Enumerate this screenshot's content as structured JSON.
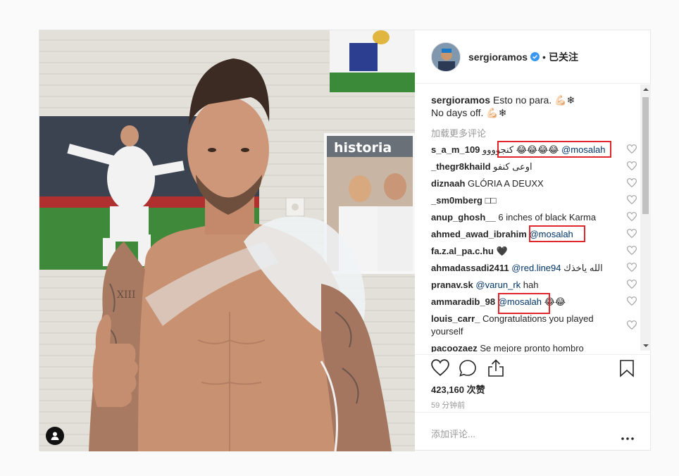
{
  "post": {
    "username": "sergioramos",
    "verified": true,
    "follow_status": "已关注",
    "caption_user": "sergioramos",
    "caption_text": "Esto no para. 💪🏻❄",
    "caption_text2": "No days off. 💪🏻❄",
    "load_more": "加载更多评论",
    "likes": "423,160 次赞",
    "time_ago": "59 分钟前",
    "add_comment_placeholder": "添加评论...",
    "photo_poster_text": "historia"
  },
  "comments": [
    {
      "user": "s_a_m_109",
      "text": "كنجوووو 😂😂😂😂",
      "mention": "@mosalah",
      "highlighted": true
    },
    {
      "user": "_thegr8khaild",
      "text": "اوعى كنفو",
      "mention": "",
      "highlighted": false
    },
    {
      "user": "diznaah",
      "text": "GLÓRIA A DEUXX",
      "mention": "",
      "highlighted": false
    },
    {
      "user": "_sm0mberg",
      "text": "□□",
      "mention": "",
      "highlighted": false
    },
    {
      "user": "anup_ghosh__",
      "text": "6 inches of black Karma",
      "mention": "",
      "highlighted": false
    },
    {
      "user": "ahmed_awad_ibrahim",
      "text": "",
      "mention": "@mosalah",
      "highlighted": true
    },
    {
      "user": "fa.z.al_pa.c.hu",
      "text": "🖤",
      "mention": "",
      "highlighted": false
    },
    {
      "user": "ahmadassadi2411",
      "text": "الله ياخذك",
      "mention": "@red.line94",
      "highlighted": false
    },
    {
      "user": "pranav.sk",
      "text": "hah",
      "mention": "@varun_rk",
      "highlighted": false
    },
    {
      "user": "ammaradib_98",
      "text": "😂😂",
      "mention": "@mosalah",
      "highlighted": true
    },
    {
      "user": "louis_carr_",
      "text": "Congratulations you played yourself",
      "mention": "",
      "highlighted": false
    },
    {
      "user": "pacoozaez",
      "text": "Se mejore pronto hombro",
      "mention": "",
      "highlighted": false
    }
  ],
  "icons": {
    "like": "heart-outline-icon",
    "comment": "speech-bubble-icon",
    "share": "share-icon",
    "save": "bookmark-icon",
    "more": "ellipsis-icon",
    "tag": "user-tag-icon",
    "verified": "verified-badge-icon"
  },
  "colors": {
    "highlight_box": "#e0262b",
    "mention": "#003569",
    "verified": "#3897f0",
    "muted": "#999999"
  }
}
